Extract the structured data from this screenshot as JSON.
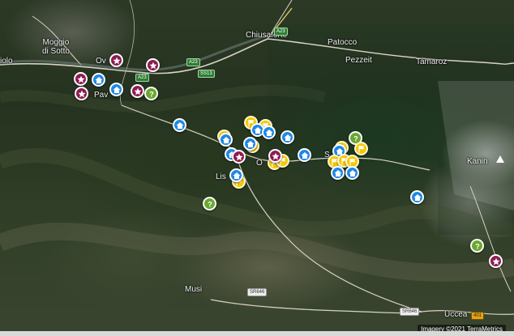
{
  "map": {
    "attribution": "Imagery ©2021 TerraMetrics",
    "place_labels": [
      {
        "id": "moggio",
        "text": "Moggio\ndi Sotto"
      },
      {
        "id": "chiusaforte",
        "text": "Chiusaforte"
      },
      {
        "id": "patocco",
        "text": "Patocco"
      },
      {
        "id": "pezzeit",
        "text": "Pezzeit"
      },
      {
        "id": "tamaroz",
        "text": "Tamaroz"
      },
      {
        "id": "kanin",
        "text": "Kanin"
      },
      {
        "id": "musi",
        "text": "Musi"
      },
      {
        "id": "uccea",
        "text": "Uccea"
      },
      {
        "id": "iolo",
        "text": "iolo"
      },
      {
        "id": "dogna-partial",
        "text": "Ov"
      },
      {
        "id": "paularo-partial",
        "text": "Pav"
      },
      {
        "id": "lis-partial",
        "text": "Lis"
      },
      {
        "id": "sella-partial",
        "text": "S"
      },
      {
        "id": "ortolan-partial",
        "text": "O"
      }
    ],
    "road_shields": [
      {
        "id": "a23-north",
        "text": "A23",
        "style": "green"
      },
      {
        "id": "a23-mid",
        "text": "A23",
        "style": "green"
      },
      {
        "id": "a23-west",
        "text": "A23",
        "style": "green"
      },
      {
        "id": "ss13",
        "text": "SS13",
        "style": "green"
      },
      {
        "id": "sr646-west",
        "text": "SR646",
        "style": "white"
      },
      {
        "id": "sr646-east",
        "text": "SR646",
        "style": "white"
      },
      {
        "id": "r401",
        "text": "401",
        "style": "orange"
      }
    ],
    "marker_types": {
      "house": {
        "color": "#1e88e5",
        "icon": "house-icon"
      },
      "star": {
        "color": "#8e1b4f",
        "icon": "star-icon"
      },
      "flag": {
        "color": "#f6c700",
        "icon": "flag-icon"
      },
      "help": {
        "color": "#6aa82e",
        "icon": "question-icon"
      }
    }
  }
}
